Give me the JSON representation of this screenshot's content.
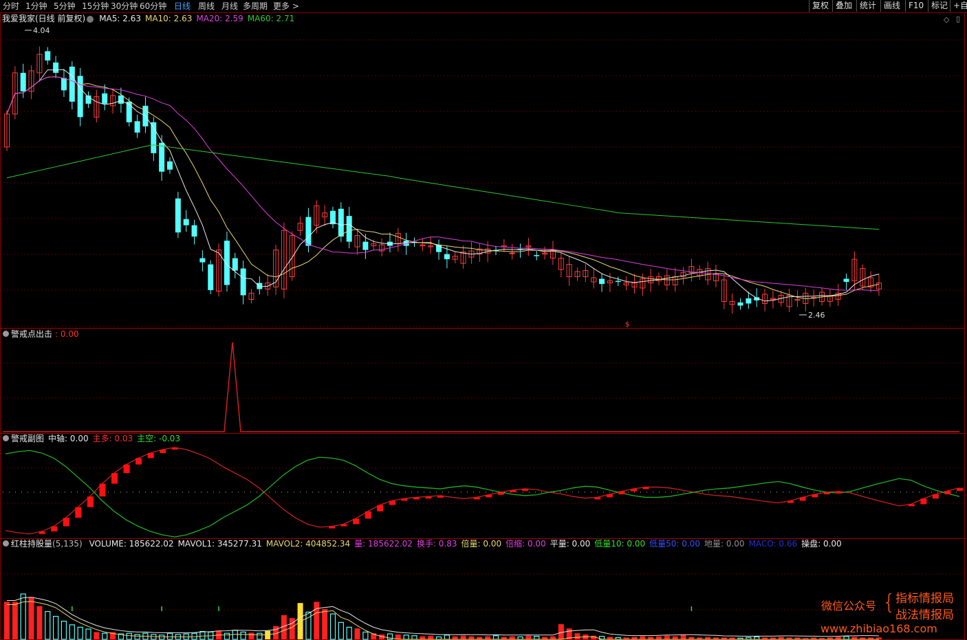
{
  "toolbar": {
    "tabs": [
      {
        "label": "分时",
        "active": false
      },
      {
        "label": "1分钟",
        "active": false
      },
      {
        "label": "5分钟",
        "active": false
      },
      {
        "label": "15分钟",
        "active": false
      },
      {
        "label": "30分钟",
        "active": false
      },
      {
        "label": "60分钟",
        "active": false
      },
      {
        "label": "日线",
        "active": true
      },
      {
        "label": "周线",
        "active": false
      },
      {
        "label": "月线",
        "active": false
      },
      {
        "label": "多周期",
        "active": false
      },
      {
        "label": "更多 >",
        "active": false
      }
    ],
    "right_buttons": [
      "复权",
      "叠加",
      "统计",
      "画线",
      "F10",
      "标记",
      "+自"
    ]
  },
  "main_panel": {
    "title": "我爱我家(日线 前复权)",
    "ma": [
      {
        "label": "MA5: 2.63",
        "color": "#e8e8e8"
      },
      {
        "label": "MA10: 2.63",
        "color": "#e8d870"
      },
      {
        "label": "MA20: 2.59",
        "color": "#e040e0"
      },
      {
        "label": "MA60: 2.71",
        "color": "#30c830"
      }
    ],
    "high_label": "4.04",
    "low_label": "2.46",
    "marker": "$"
  },
  "panel2": {
    "title": "警戒点出击",
    "value": ": 0.00"
  },
  "panel3": {
    "title": "警戒副图",
    "items": [
      {
        "label": "中轴: 0.00",
        "color": "#e8e8e8"
      },
      {
        "label": "主多: 0.03",
        "color": "#ff3030"
      },
      {
        "label": "主空: -0.03",
        "color": "#30e030"
      }
    ]
  },
  "panel4": {
    "title": "红柱持股量",
    "params": "(5,135)",
    "items": [
      {
        "label": "VOLUME: 185622.02",
        "color": "#e8e8e8"
      },
      {
        "label": "MAVOL1: 345277.31",
        "color": "#e8e8e8"
      },
      {
        "label": "MAVOL2: 404852.34",
        "color": "#e8d870"
      },
      {
        "label": "量: 185622.02",
        "color": "#e040e0"
      },
      {
        "label": "换手: 0.83",
        "color": "#e040e0"
      },
      {
        "label": "倍量: 0.00",
        "color": "#e8d870"
      },
      {
        "label": "倍缩: 0.00",
        "color": "#e040e0"
      },
      {
        "label": "平量: 0.00",
        "color": "#e8e8e8"
      },
      {
        "label": "低量10: 0.00",
        "color": "#30e030"
      },
      {
        "label": "低量50: 0.00",
        "color": "#3050ff"
      },
      {
        "label": "地量: 0.00",
        "color": "#909090"
      },
      {
        "label": "MACO: 0.66",
        "color": "#2030d0"
      },
      {
        "label": "操盘: 0.00",
        "color": "#e8e8e8"
      }
    ]
  },
  "watermark": {
    "left": "微信公众号",
    "right1": "指标情报局",
    "right2": "战法情报局",
    "url": "www.zhibiao168.com"
  },
  "chart_data": {
    "type": "candlestick",
    "prices": {
      "o": [
        2.88,
        3.2,
        3.6,
        3.42,
        3.6,
        3.81,
        3.7,
        3.55,
        3.66,
        3.57,
        3.38,
        3.17,
        3.4,
        3.28,
        3.38,
        3.32,
        3.13,
        3.28,
        3.12,
        2.92,
        2.74,
        2.38,
        2.18,
        2.12,
        1.8,
        1.74,
        1.48,
        1.97,
        1.8,
        1.7,
        1.4,
        1.56,
        1.5,
        1.52,
        1.5,
        1.62,
        2.07,
        2.2,
        2.12,
        2.2,
        2.26,
        2.28,
        2.21,
        1.91,
        1.96,
        1.92,
        1.87,
        1.96,
        1.94,
        1.97,
        1.96,
        1.92,
        1.91,
        1.93,
        1.84,
        1.79,
        1.75,
        1.81,
        1.84,
        1.85,
        1.88,
        1.91,
        1.85,
        1.89,
        1.91,
        1.83,
        1.84,
        1.8,
        1.69,
        1.62,
        1.62,
        1.62,
        1.57,
        1.6,
        1.56,
        1.58,
        1.54,
        1.52,
        1.51,
        1.56,
        1.58,
        1.54,
        1.54,
        1.62,
        1.66,
        1.63,
        1.59,
        1.58,
        1.38,
        1.35,
        1.37,
        1.41,
        1.42,
        1.36,
        1.4,
        1.37,
        1.33,
        1.39,
        1.36,
        1.42,
        1.38,
        1.38,
        1.4,
        1.6,
        1.58,
        1.53,
        1.52,
        1.5
      ],
      "c": [
        3.2,
        3.6,
        3.42,
        3.62,
        3.78,
        3.72,
        3.6,
        3.43,
        3.32,
        3.17,
        3.3,
        3.37,
        3.3,
        3.38,
        3.3,
        3.12,
        3.02,
        3.08,
        2.82,
        2.64,
        2.66,
        2.05,
        2.12,
        2.01,
        1.76,
        1.49,
        1.88,
        1.54,
        1.68,
        1.44,
        1.46,
        1.5,
        1.56,
        1.88,
        2.07,
        2.02,
        2.14,
        1.92,
        2.31,
        2.24,
        2.13,
        2.01,
        1.96,
        2.02,
        1.88,
        1.94,
        1.93,
        1.92,
        2.04,
        1.92,
        1.95,
        1.93,
        1.92,
        1.86,
        1.79,
        1.82,
        1.86,
        1.87,
        1.89,
        1.89,
        1.87,
        1.92,
        1.85,
        1.88,
        1.92,
        1.82,
        1.85,
        1.88,
        1.8,
        1.74,
        1.67,
        1.68,
        1.61,
        1.55,
        1.58,
        1.57,
        1.56,
        1.56,
        1.6,
        1.62,
        1.62,
        1.63,
        1.62,
        1.66,
        1.72,
        1.69,
        1.7,
        1.65,
        1.59,
        1.38,
        1.34,
        1.36,
        1.39,
        1.45,
        1.41,
        1.44,
        1.44,
        1.4,
        1.46,
        1.42,
        1.47,
        1.43,
        1.46,
        1.57,
        1.79,
        1.7,
        1.61,
        1.56
      ]
    },
    "panel2_peak": "single spike",
    "ylim": [
      1.2,
      4.1
    ]
  }
}
